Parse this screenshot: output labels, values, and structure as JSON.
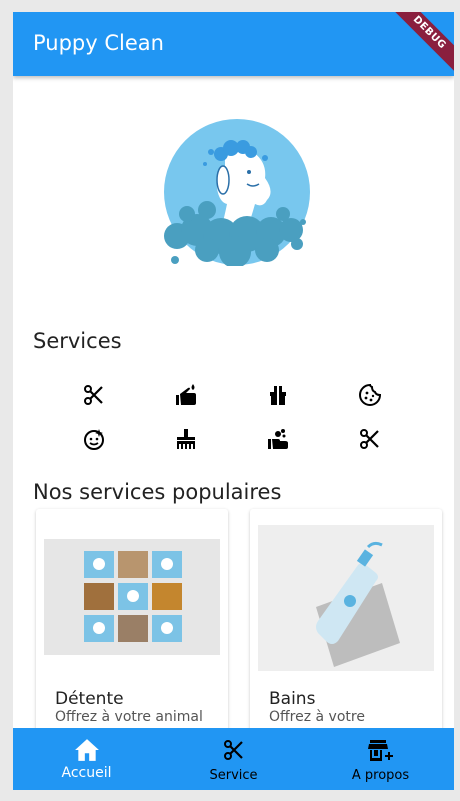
{
  "app": {
    "title": "Puppy Clean",
    "debug_banner": "DEBUG"
  },
  "sections": {
    "services_title": "Services",
    "popular_title": "Nos services populaires"
  },
  "services_icons": [
    "scissors-icon",
    "hand-soap-icon",
    "gift-icon",
    "cookie-icon",
    "face-icon",
    "brush-icon",
    "hand-wash-icon",
    "scissors-icon"
  ],
  "cards": [
    {
      "name": "Détente",
      "desc": "Offrez à votre animal"
    },
    {
      "name": "Bains",
      "desc": "Offrez à votre"
    }
  ],
  "nav": [
    {
      "label": "Accueil",
      "icon": "home-icon",
      "active": true
    },
    {
      "label": "Service",
      "icon": "scissors-icon",
      "active": false
    },
    {
      "label": "A propos",
      "icon": "add-store-icon",
      "active": false
    }
  ],
  "colors": {
    "primary": "#2196F3",
    "debug": "#8a1f3e"
  }
}
